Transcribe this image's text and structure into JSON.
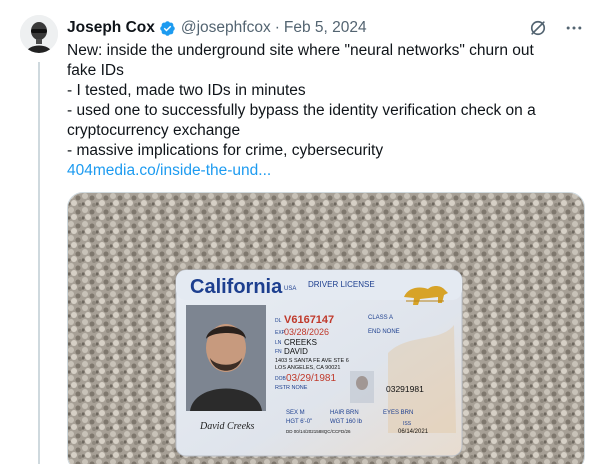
{
  "tweet": {
    "display_name": "Joseph Cox",
    "handle": "@josephfcox",
    "separator": "·",
    "date": "Feb 5, 2024",
    "lines": [
      "New: inside the underground site where \"neural networks\" churn out fake IDs",
      "- I tested, made two IDs in minutes",
      "- used one to successfully bypass the identity verification check on a cryptocurrency exchange",
      "- massive implications for crime, cybersecurity"
    ],
    "link_text": "404media.co/inside-the-und..."
  },
  "icons": {
    "verified": "verified-badge-icon",
    "grok": "grok-icon",
    "more": "more-icon"
  },
  "colors": {
    "link": "#1d9bf0",
    "verified": "#1d9bf0",
    "secondary_text": "#536471"
  },
  "id_card": {
    "state": "California",
    "usa": "USA",
    "type": "DRIVER LICENSE",
    "dl_label": "DL",
    "dl_number": "V6167147",
    "class_label": "CLASS A",
    "exp_label": "EXP",
    "exp_date": "03/28/2026",
    "end_label": "END NONE",
    "ln_label": "LN",
    "last_name": "CREEKS",
    "fn_label": "FN",
    "first_name": "DAVID",
    "address_1": "1403 S SANTA FE AVE STE 6",
    "address_2": "LOS ANGELES, CA 90021",
    "dob_label": "DOB",
    "dob": "03/29/1981",
    "rstr": "RSTR NONE",
    "id_number": "03291981",
    "sex": "SEX M",
    "hair": "HAIR BRN",
    "eyes": "EYES BRN",
    "hgt": "HGT 6'-0\"",
    "wgt": "WGT 160 lb",
    "iss_label": "ISS",
    "iss_date": "06/14/2021",
    "dd": "DD 00/14/2021588QC/CCFD/26",
    "signature": "David Creeks"
  }
}
